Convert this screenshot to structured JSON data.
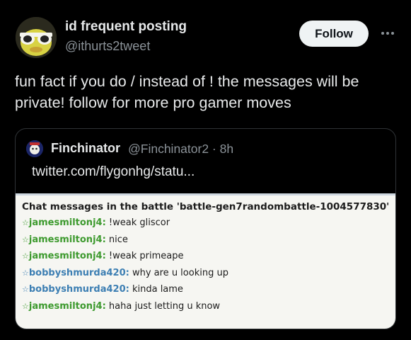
{
  "author": {
    "display_name": "id frequent posting",
    "handle": "@ithurts2tweet"
  },
  "follow_label": "Follow",
  "tweet_text": "fun fact if you do / instead of ! the messages will be private! follow for more pro gamer moves",
  "quoted": {
    "display_name": "Finchinator",
    "handle_time": "@Finchinator2 · 8h",
    "link": "twitter.com/flygonhg/statu..."
  },
  "chat": {
    "title": "Chat messages in the battle 'battle-gen7randombattle-1004577830'",
    "messages": [
      {
        "star": "☆",
        "user": "jamesmiltonj4:",
        "text": "!weak gliscor",
        "color": "#3d9a2e"
      },
      {
        "star": "☆",
        "user": "jamesmiltonj4:",
        "text": "nice",
        "color": "#3d9a2e"
      },
      {
        "star": "☆",
        "user": "jamesmiltonj4:",
        "text": "!weak primeape",
        "color": "#3d9a2e"
      },
      {
        "star": "☆",
        "user": "bobbyshmurda420:",
        "text": "why are u looking up",
        "color": "#3d7fb3"
      },
      {
        "star": "☆",
        "user": "bobbyshmurda420:",
        "text": "kinda lame",
        "color": "#3d7fb3"
      },
      {
        "star": "☆",
        "user": "jamesmiltonj4:",
        "text": "haha just letting u know",
        "color": "#3d9a2e"
      }
    ]
  },
  "icons": {
    "more": "more-options-icon",
    "avatar": "yellow-duck-with-sunglasses",
    "quoted_avatar": "cartoon-avatar"
  }
}
